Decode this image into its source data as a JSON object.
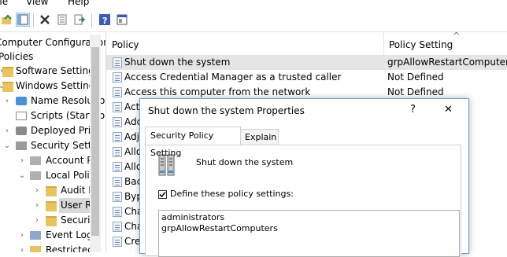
{
  "menu": [
    "File",
    "View",
    "Help"
  ],
  "tree": [
    {
      "label": "Computer Configuration",
      "indent": 0
    },
    {
      "label": "Policies",
      "indent": 0
    },
    {
      "label": "Software Settings",
      "indent": 1
    },
    {
      "label": "Windows Settings",
      "indent": 1
    },
    {
      "label": "Name Resolution",
      "indent": 2
    },
    {
      "label": "Scripts (Startup",
      "indent": 2
    },
    {
      "label": "Deployed Prin",
      "indent": 2
    },
    {
      "label": "Security Settin",
      "indent": 2
    },
    {
      "label": "Account P",
      "indent": 3
    },
    {
      "label": "Local Polic",
      "indent": 3
    },
    {
      "label": "Audit P",
      "indent": 4
    },
    {
      "label": "User Ri",
      "indent": 4
    },
    {
      "label": "Securit",
      "indent": 4
    },
    {
      "label": "Event Log",
      "indent": 3
    },
    {
      "label": "Restricted",
      "indent": 3
    }
  ],
  "list": {
    "col_policy": "Policy",
    "col_setting": "Policy Setting",
    "rows": [
      {
        "policy": "Shut down the system",
        "setting": "grpAllowRestartComputers,a"
      },
      {
        "policy": "Access Credential Manager as a trusted caller",
        "setting": "Not Defined"
      },
      {
        "policy": "Access this computer from the network",
        "setting": "Not Defined"
      },
      {
        "policy": "Act",
        "setting": ""
      },
      {
        "policy": "Add",
        "setting": ""
      },
      {
        "policy": "Adj",
        "setting": ""
      },
      {
        "policy": "Allo",
        "setting": ""
      },
      {
        "policy": "Allo",
        "setting": ""
      },
      {
        "policy": "Bac",
        "setting": ""
      },
      {
        "policy": "Byp",
        "setting": ""
      },
      {
        "policy": "Cha",
        "setting": ""
      },
      {
        "policy": "Cha",
        "setting": ""
      },
      {
        "policy": "Cre",
        "setting": ""
      }
    ]
  },
  "dialog": {
    "title": "Shut down the system Properties",
    "help": "?",
    "close": "✕",
    "tab_active": "Security Policy Setting",
    "tab_explain": "Explain",
    "policy_name": "Shut down the system",
    "define_label": "Define these policy settings:",
    "define_checked": true,
    "entries": [
      "administrators",
      "grpAllowRestartComputers"
    ]
  }
}
